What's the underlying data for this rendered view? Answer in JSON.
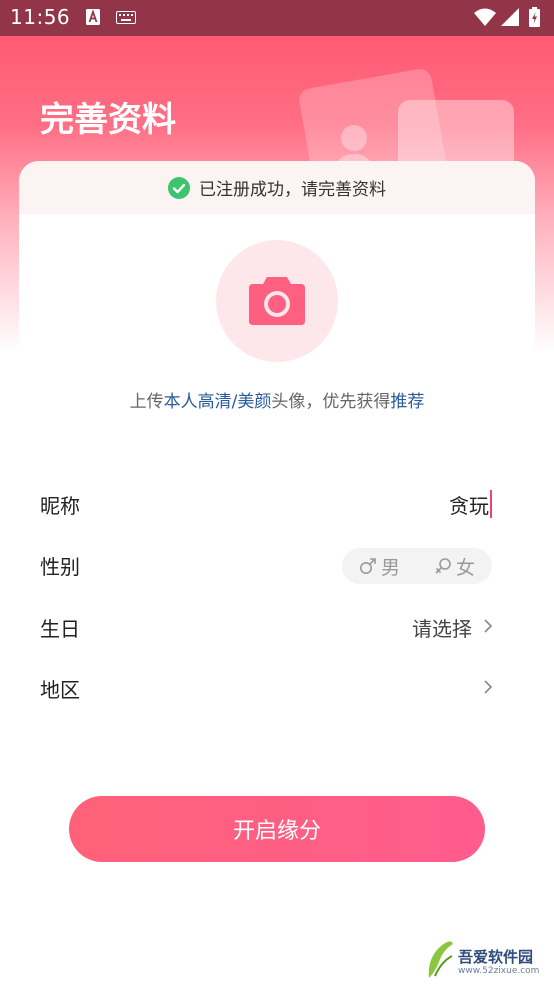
{
  "status_bar": {
    "time": "11:56"
  },
  "header": {
    "title": "完善资料"
  },
  "notice": {
    "text": "已注册成功，请完善资料",
    "color": "#3cc46f"
  },
  "avatar": {
    "hint_1": "上传",
    "hint_2": "本人高清/美颜",
    "hint_3": "头像，优先获得",
    "hint_4": "推荐"
  },
  "form": {
    "nickname": {
      "label": "昵称",
      "value": "贪玩"
    },
    "gender": {
      "label": "性别",
      "male": "男",
      "female": "女"
    },
    "birthday": {
      "label": "生日",
      "value": "请选择"
    },
    "region": {
      "label": "地区",
      "value": ""
    }
  },
  "cta": {
    "label": "开启缘分"
  },
  "watermark": {
    "text": "吾爱软件园",
    "url": "www.52zixue.com"
  },
  "colors": {
    "accent": "#ff5f80",
    "link": "#2b5a9a",
    "status_bar": "#923548"
  }
}
